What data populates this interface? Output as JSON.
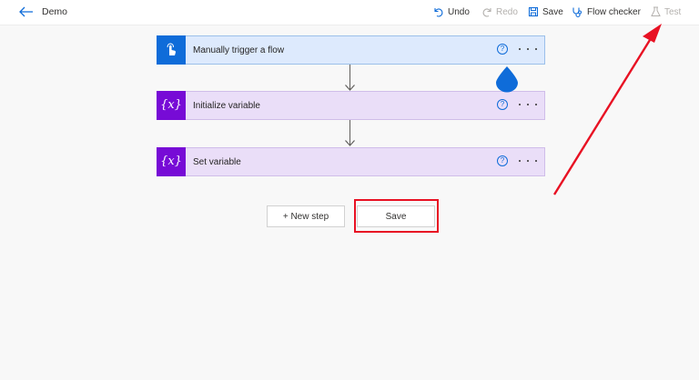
{
  "header": {
    "flow_name": "Demo",
    "undo_label": "Undo",
    "redo_label": "Redo",
    "save_label": "Save",
    "flow_checker_label": "Flow checker",
    "test_label": "Test"
  },
  "steps": [
    {
      "title": "Manually trigger a flow",
      "icon": "touch-trigger-icon",
      "help": "?"
    },
    {
      "title": "Initialize variable",
      "icon": "variable-icon",
      "help": "?",
      "icon_text": "{x}"
    },
    {
      "title": "Set variable",
      "icon": "variable-icon",
      "help": "?",
      "icon_text": "{x}"
    }
  ],
  "actions": {
    "new_step_label": "+ New step",
    "save_label": "Save"
  },
  "colors": {
    "accent": "#0f6cd9",
    "trigger_bg": "#ddeafd",
    "variable_icon": "#770bd6",
    "variable_bg": "#eadef8",
    "annotation": "#e81123"
  }
}
